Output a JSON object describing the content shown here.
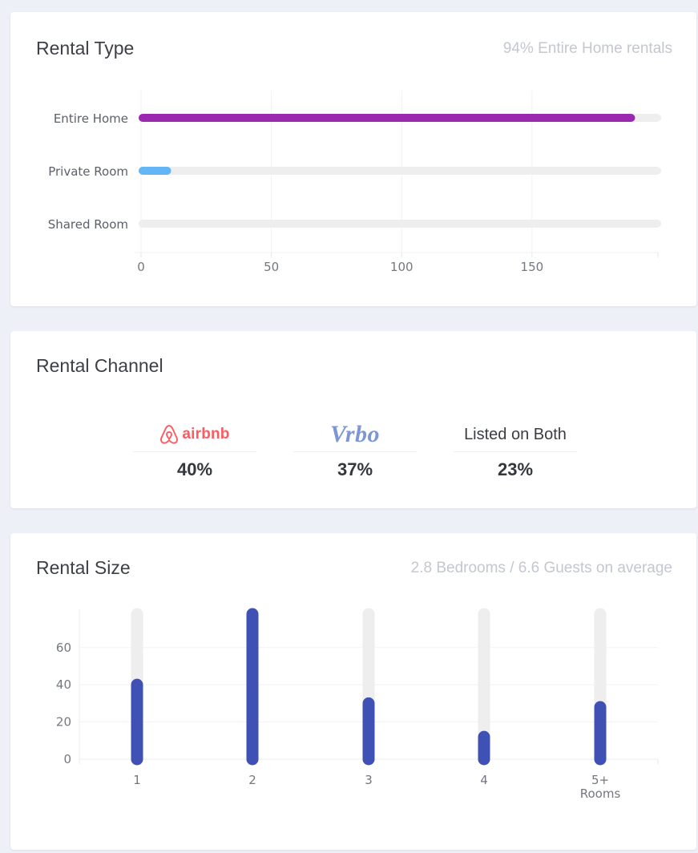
{
  "rental_type": {
    "title": "Rental Type",
    "subtitle": "94% Entire Home rentals",
    "colors": {
      "entire_home": "#9c27b0",
      "private_room": "#64b5f6",
      "track": "#eeeeee"
    }
  },
  "rental_channel": {
    "title": "Rental Channel",
    "channels": [
      {
        "logo_text": "airbnb",
        "icon": "airbnb-logo-icon",
        "percent": "40%",
        "color": "#ff5a5f"
      },
      {
        "logo_text": "Vrbo",
        "icon": "vrbo-logo",
        "percent": "37%",
        "color": "#7c96d6"
      },
      {
        "logo_text": "Listed on Both",
        "percent": "23%"
      }
    ]
  },
  "rental_size": {
    "title": "Rental Size",
    "subtitle": "2.8 Bedrooms / 6.6 Guests on average",
    "colors": {
      "bar": "#3f51b5",
      "track": "#eeeeee"
    }
  },
  "chart_data": [
    {
      "type": "bar",
      "orientation": "horizontal",
      "categories": [
        "Entire Home",
        "Private Room",
        "Shared Room"
      ],
      "values": [
        188,
        10,
        0
      ],
      "xlim": [
        0,
        198
      ],
      "xticks": [
        0,
        50,
        100,
        150
      ],
      "grid": true,
      "title": "Rental Type"
    },
    {
      "type": "bar",
      "orientation": "vertical",
      "categories": [
        "1",
        "2",
        "3",
        "4",
        "5+\nRooms"
      ],
      "values": [
        40,
        78,
        30,
        12,
        28
      ],
      "ylim": [
        0,
        78
      ],
      "yticks": [
        0,
        20,
        40,
        60
      ],
      "grid": true,
      "title": "Rental Size"
    }
  ]
}
